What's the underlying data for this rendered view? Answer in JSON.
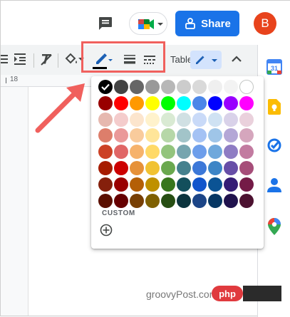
{
  "header": {
    "share_label": "Share",
    "avatar_initial": "B"
  },
  "toolbar": {
    "table_label": "Table",
    "icons": [
      "outdent-icon",
      "indent-icon",
      "clear-formatting-icon",
      "fill-color-icon",
      "border-color-icon",
      "border-width-icon",
      "border-dash-icon",
      "table-pen-icon",
      "collapse-icon"
    ]
  },
  "ruler": {
    "value": "18"
  },
  "palette": {
    "selected": "#000000",
    "custom_label": "CUSTOM",
    "rows": [
      [
        "#000000",
        "#434343",
        "#666666",
        "#999999",
        "#b7b7b7",
        "#cccccc",
        "#d9d9d9",
        "#efefef",
        "#f3f3f3",
        "#ffffff"
      ],
      [
        "#980000",
        "#ff0000",
        "#ff9900",
        "#ffff00",
        "#00ff00",
        "#00ffff",
        "#4a86e8",
        "#0000ff",
        "#9900ff",
        "#ff00ff"
      ],
      [
        "#e6b8af",
        "#f4cccc",
        "#fce5cd",
        "#fff2cc",
        "#d9ead3",
        "#d0e0e3",
        "#c9daf8",
        "#cfe2f3",
        "#d9d2e9",
        "#ead1dc"
      ],
      [
        "#dd7e6b",
        "#ea9999",
        "#f9cb9c",
        "#ffe599",
        "#b6d7a8",
        "#a2c4c9",
        "#a4c2f4",
        "#9fc5e8",
        "#b4a7d6",
        "#d5a6bd"
      ],
      [
        "#cc4125",
        "#e06666",
        "#f6b26b",
        "#ffd966",
        "#93c47d",
        "#76a5af",
        "#6d9eeb",
        "#6fa8dc",
        "#8e7cc3",
        "#c27ba0"
      ],
      [
        "#a61c00",
        "#cc0000",
        "#e69138",
        "#f1c232",
        "#6aa84f",
        "#45818e",
        "#3c78d8",
        "#3d85c6",
        "#674ea7",
        "#a64d79"
      ],
      [
        "#85200c",
        "#990000",
        "#b45f06",
        "#bf9000",
        "#38761d",
        "#134f5c",
        "#1155cc",
        "#0b5394",
        "#351c75",
        "#741b47"
      ],
      [
        "#5b0f00",
        "#660000",
        "#783f04",
        "#7f6000",
        "#274e13",
        "#0c343d",
        "#1c4587",
        "#073763",
        "#20124d",
        "#4c1130"
      ]
    ]
  },
  "side_panel": {
    "apps": [
      "calendar-icon",
      "keep-icon",
      "tasks-icon",
      "contacts-icon",
      "maps-icon"
    ]
  },
  "colors": {
    "accent": "#1a73e8",
    "highlight": "#f0605d",
    "avatar": "#e8431c"
  },
  "watermark": {
    "text": "groovyPost.com",
    "logo_text": "php"
  }
}
